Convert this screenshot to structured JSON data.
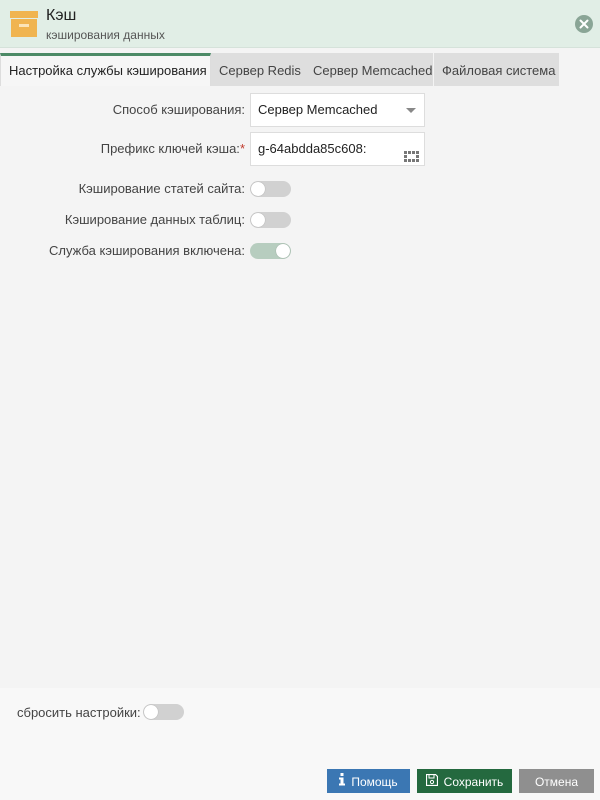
{
  "window": {
    "title": "Кэш",
    "subtitle": "кэширования данных"
  },
  "tabs": [
    {
      "label": "Настройка службы кэширования",
      "active": true
    },
    {
      "label": "Сервер Redis",
      "active": false
    },
    {
      "label": "Сервер Memcached",
      "active": false
    },
    {
      "label": "Файловая система",
      "active": false
    }
  ],
  "form": {
    "cache_method": {
      "label": "Способ кэширования:",
      "value": "Сервер Memcached"
    },
    "key_prefix": {
      "label": "Префикс ключей кэша:",
      "required_mark": "*",
      "value": "g-64abdda85c608:"
    },
    "cache_articles": {
      "label": "Кэширование статей сайта:",
      "enabled": false
    },
    "cache_tables": {
      "label": "Кэширование данных таблиц:",
      "enabled": false
    },
    "cache_service": {
      "label": "Служба кэширования включена:",
      "enabled": true
    }
  },
  "footer": {
    "reset_label": "сбросить настройки:",
    "reset_enabled": false,
    "help_label": "Помощь",
    "save_label": "Сохранить",
    "cancel_label": "Отмена"
  },
  "colors": {
    "header_bg": "#e1eee6",
    "accent": "#4c8a66",
    "help_button": "#3b77b3",
    "save_button": "#24693f",
    "cancel_button": "#8f8f8f",
    "toggle_on": "#b7cdbf",
    "toggle_off": "#d1d1d1",
    "icon_orange": "#f0b450"
  },
  "icons": {
    "app": "archive-box-icon",
    "close": "close-circle-icon",
    "prefix_generator": "grid-icon",
    "help": "info-icon",
    "save": "floppy-disk-icon"
  }
}
